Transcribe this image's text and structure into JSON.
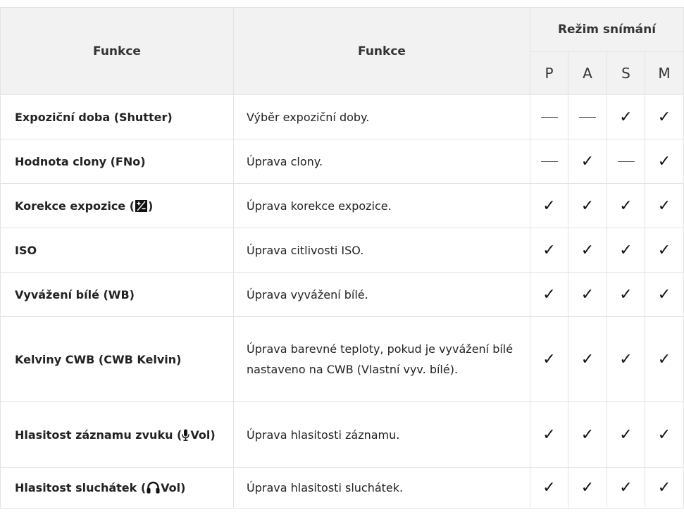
{
  "header": {
    "col_function": "Funkce",
    "col_description": "Funkce",
    "mode_group": "Režim snímání",
    "modes": [
      "P",
      "A",
      "S",
      "M"
    ]
  },
  "marks": {
    "check": "✓",
    "dash_label": "—"
  },
  "rows": [
    {
      "function": "Expoziční doba (Shutter)",
      "description": "Výběr expoziční doby.",
      "modes": [
        "dash",
        "dash",
        "check",
        "check"
      ]
    },
    {
      "function": "Hodnota clony (FNo)",
      "description": "Úprava clony.",
      "modes": [
        "dash",
        "check",
        "dash",
        "check"
      ]
    },
    {
      "function_pre": "Korekce expozice (",
      "function_icon": "exposure-compensation-icon",
      "function_post": ")",
      "description": "Úprava korekce expozice.",
      "modes": [
        "check",
        "check",
        "check",
        "check"
      ]
    },
    {
      "function": "ISO",
      "description": "Úprava citlivosti ISO.",
      "modes": [
        "check",
        "check",
        "check",
        "check"
      ]
    },
    {
      "function": "Vyvážení bílé (WB)",
      "description": "Úprava vyvážení bílé.",
      "modes": [
        "check",
        "check",
        "check",
        "check"
      ]
    },
    {
      "function": "Kelviny CWB (CWB Kelvin)",
      "description": "Úprava barevné teploty, pokud je vyvážení bílé nastaveno na CWB (Vlastní vyv. bílé).",
      "modes": [
        "check",
        "check",
        "check",
        "check"
      ]
    },
    {
      "function_pre": "Hlasitost záznamu zvuku (",
      "function_icon": "microphone-icon",
      "function_post": "Vol)",
      "description": "Úprava hlasitosti záznamu.",
      "modes": [
        "check",
        "check",
        "check",
        "check"
      ]
    },
    {
      "function_pre": "Hlasitost sluchátek (",
      "function_icon": "headphones-icon",
      "function_post": "Vol)",
      "description": "Úprava hlasitosti sluchátek.",
      "modes": [
        "check",
        "check",
        "check",
        "check"
      ]
    }
  ]
}
